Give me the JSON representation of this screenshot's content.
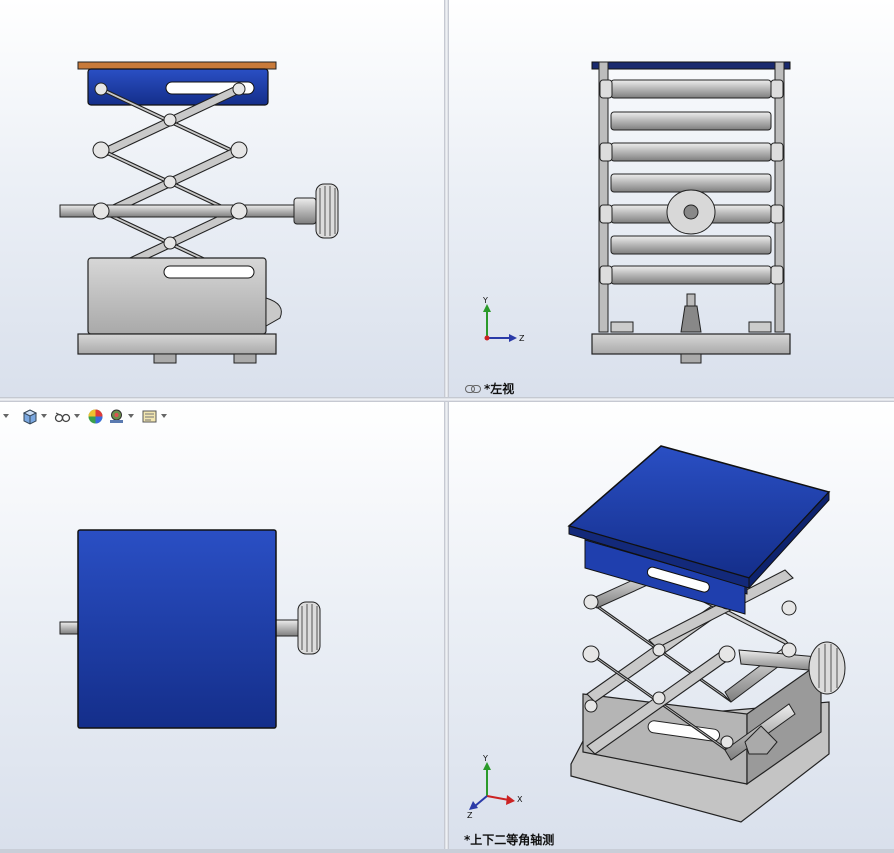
{
  "viewports": {
    "front": {
      "label": ""
    },
    "left": {
      "label": "*左视"
    },
    "top": {
      "label": ""
    },
    "isometric": {
      "label": "*上下二等角轴测"
    }
  },
  "triad": {
    "x_label": "X",
    "y_label": "Y",
    "z_label": "Z"
  },
  "toolbar": {
    "items": [
      {
        "icon": "view-orientation-icon"
      },
      {
        "icon": "display-style-icon"
      },
      {
        "icon": "hide-show-items-icon"
      },
      {
        "icon": "edit-appearance-icon"
      },
      {
        "icon": "apply-scene-icon"
      },
      {
        "icon": "view-settings-icon"
      }
    ]
  },
  "colors": {
    "platform_blue": "#1a3a9e",
    "steel": "#c8c8c8",
    "steel_dark": "#8a8a8a",
    "outline": "#222222"
  }
}
